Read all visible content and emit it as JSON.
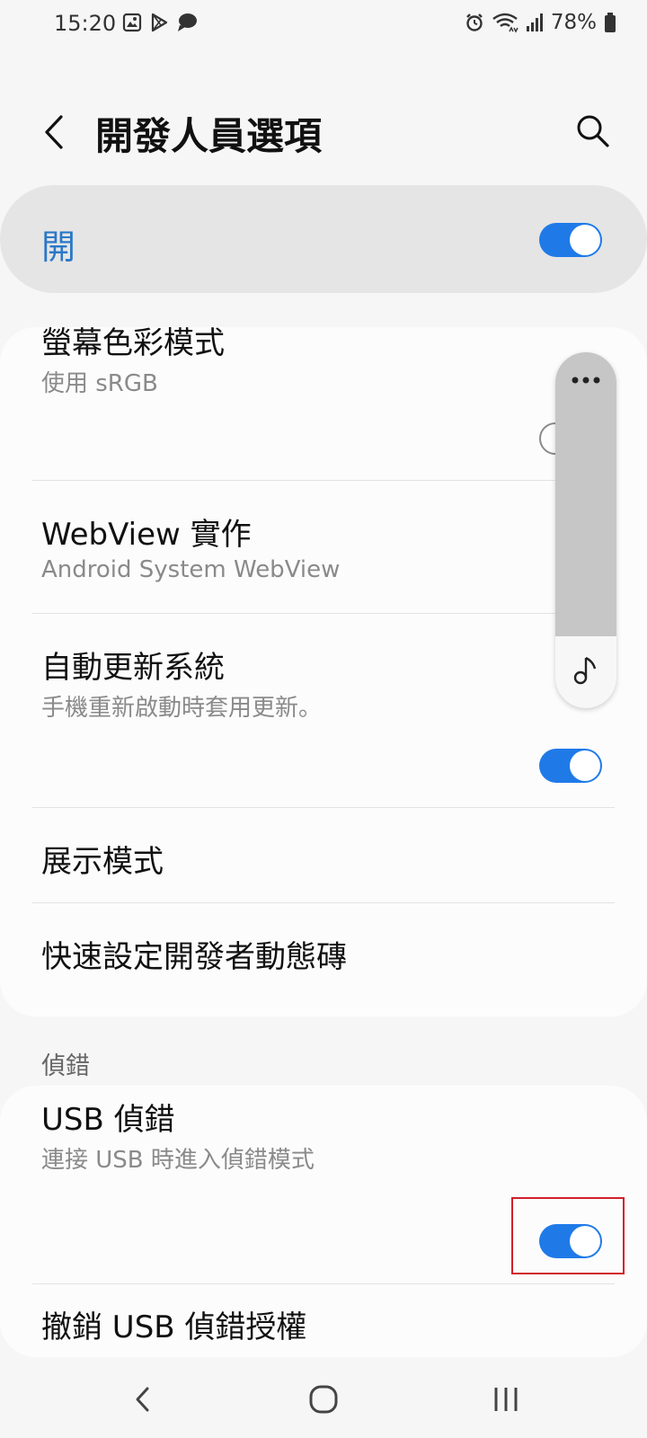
{
  "status_bar": {
    "time": "15:20",
    "battery": "78%",
    "left_icons": [
      "gallery-icon",
      "play-store-icon",
      "message-icon"
    ],
    "right_icons": [
      "alarm-icon",
      "wifi-icon",
      "signal-icon",
      "battery-icon"
    ]
  },
  "header": {
    "title": "開發人員選項",
    "back_icon": "back-icon",
    "search_icon": "search-icon"
  },
  "master_switch": {
    "label": "開",
    "state": "on"
  },
  "settings": [
    {
      "title": "螢幕色彩模式",
      "subtitle": "使用 sRGB",
      "toggle": "off"
    },
    {
      "title": "WebView 實作",
      "subtitle": "Android System WebView"
    },
    {
      "title": "自動更新系統",
      "subtitle": "手機重新啟動時套用更新。",
      "toggle": "on"
    },
    {
      "title": "展示模式"
    },
    {
      "title": "快速設定開發者動態磚"
    }
  ],
  "debug_section": {
    "header": "偵錯",
    "items": [
      {
        "title": "USB 偵錯",
        "subtitle": "連接 USB 時進入偵錯模式",
        "toggle": "on"
      },
      {
        "title": "撤銷 USB 偵錯授權"
      }
    ]
  },
  "floating_panel": {
    "icons": [
      "more-icon",
      "music-note-icon"
    ]
  },
  "nav_bar": {
    "icons": [
      "nav-back-icon",
      "nav-home-icon",
      "nav-recents-icon"
    ]
  },
  "colors": {
    "accent": "#1f7ae8",
    "master_label": "#2a78c8",
    "highlight": "#d0202a",
    "background": "#f6f6f6",
    "card": "#fcfcfc"
  }
}
